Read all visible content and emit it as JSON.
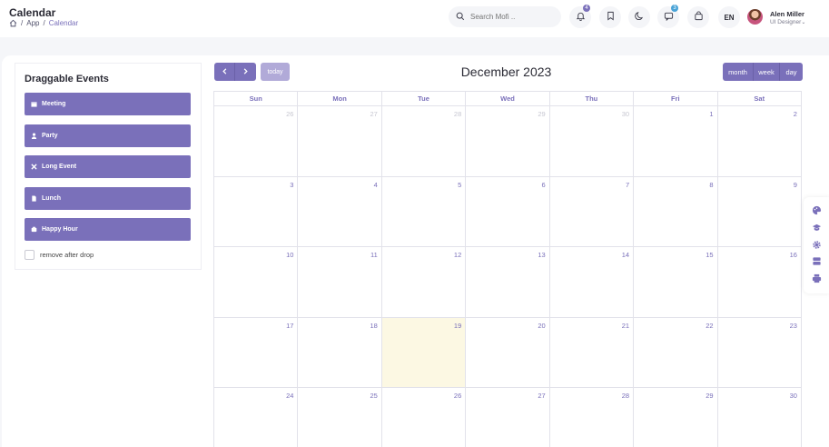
{
  "header": {
    "page_title": "Calendar",
    "breadcrumb": [
      "App",
      "Calendar"
    ],
    "search_placeholder": "Search Mofi ..",
    "notification_count": "4",
    "messages_count": "3",
    "language": "EN",
    "user_name": "Alen Miller",
    "user_role": "UI Designer"
  },
  "events_panel": {
    "title": "Draggable Events",
    "events": [
      {
        "label": "Meeting",
        "icon": "calendar-icon"
      },
      {
        "label": "Party",
        "icon": "user-icon"
      },
      {
        "label": "Long Event",
        "icon": "airplane-icon"
      },
      {
        "label": "Lunch",
        "icon": "document-icon"
      },
      {
        "label": "Happy Hour",
        "icon": "box-icon"
      }
    ],
    "remove_after_drop": "remove after drop"
  },
  "calendar": {
    "title": "December 2023",
    "today_label": "today",
    "views": [
      "month",
      "week",
      "day"
    ],
    "weekdays": [
      "Sun",
      "Mon",
      "Tue",
      "Wed",
      "Thu",
      "Fri",
      "Sat"
    ],
    "weeks": [
      [
        {
          "d": "26",
          "other": true
        },
        {
          "d": "27",
          "other": true
        },
        {
          "d": "28",
          "other": true
        },
        {
          "d": "29",
          "other": true
        },
        {
          "d": "30",
          "other": true
        },
        {
          "d": "1"
        },
        {
          "d": "2"
        }
      ],
      [
        {
          "d": "3"
        },
        {
          "d": "4"
        },
        {
          "d": "5"
        },
        {
          "d": "6"
        },
        {
          "d": "7"
        },
        {
          "d": "8"
        },
        {
          "d": "9"
        }
      ],
      [
        {
          "d": "10"
        },
        {
          "d": "11"
        },
        {
          "d": "12"
        },
        {
          "d": "13"
        },
        {
          "d": "14"
        },
        {
          "d": "15"
        },
        {
          "d": "16"
        }
      ],
      [
        {
          "d": "17"
        },
        {
          "d": "18"
        },
        {
          "d": "19",
          "today": true
        },
        {
          "d": "20"
        },
        {
          "d": "21"
        },
        {
          "d": "22"
        },
        {
          "d": "23"
        }
      ],
      [
        {
          "d": "24"
        },
        {
          "d": "25"
        },
        {
          "d": "26"
        },
        {
          "d": "27"
        },
        {
          "d": "28"
        },
        {
          "d": "29"
        },
        {
          "d": "30"
        }
      ]
    ]
  },
  "colors": {
    "accent": "#7a70ba",
    "accent_light": "#b1aad8",
    "today_bg": "#fcf8e3",
    "badge_primary": "#7a70ba",
    "badge_info": "#48a3d7"
  }
}
